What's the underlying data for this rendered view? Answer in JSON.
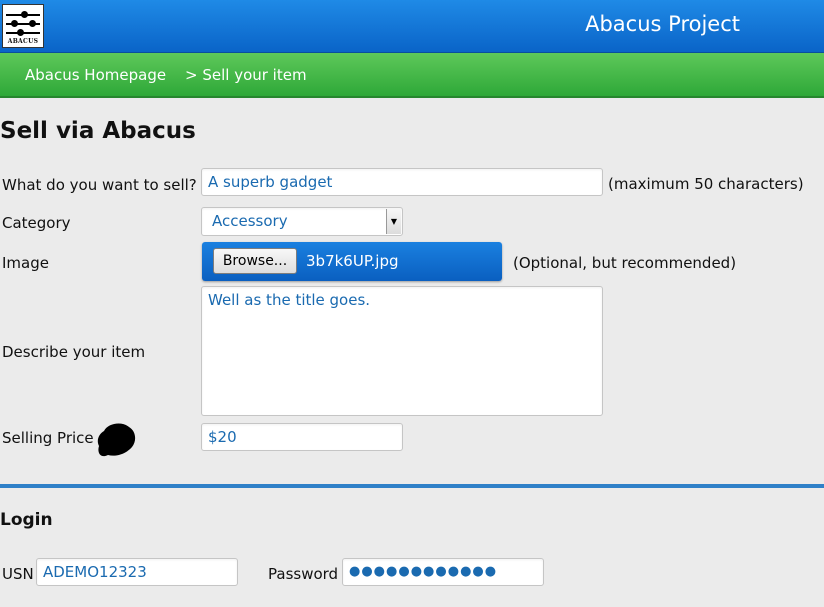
{
  "header": {
    "logo_text": "ABACUS",
    "app_title": "Abacus Project"
  },
  "nav": {
    "home": "Abacus Homepage",
    "breadcrumb": "> Sell your item"
  },
  "form": {
    "title": "Sell via Abacus",
    "item": {
      "label": "What do you want to sell?",
      "value": "A superb gadget",
      "hint": "(maximum 50 characters)"
    },
    "category": {
      "label": "Category",
      "value": "Accessory",
      "arrow_icon": "dropdown-arrow-icon"
    },
    "image": {
      "label": "Image",
      "browse_label": "Browse...",
      "file_name": "3b7k6UP.jpg",
      "hint": "(Optional, but recommended)"
    },
    "description": {
      "label": "Describe your item",
      "value": "Well as the title goes."
    },
    "price": {
      "label": "Selling Price",
      "value": "$20"
    }
  },
  "login": {
    "title": "Login",
    "usn_label": "USN",
    "usn_value": "ADEMO12323",
    "password_label": "Password",
    "password_value": "●●●●●●●●●●●●"
  },
  "colors": {
    "header_blue": "#0a64c8",
    "nav_green": "#2ea838",
    "input_text": "#1a6ab0",
    "divider": "#2f80c8"
  }
}
